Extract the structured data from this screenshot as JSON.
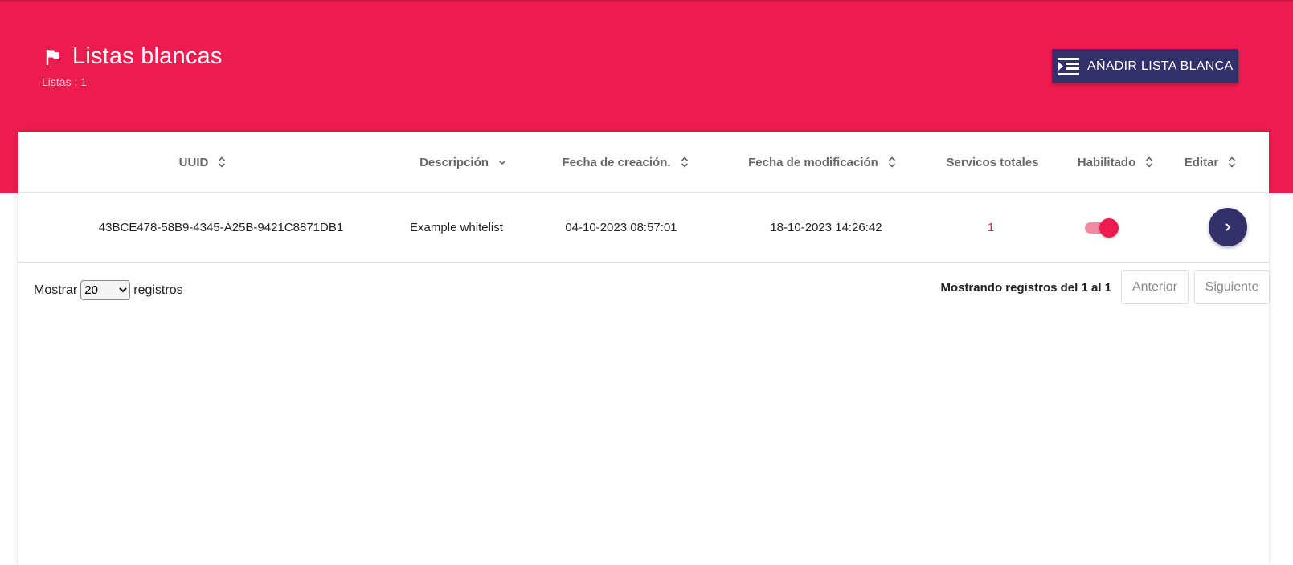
{
  "header": {
    "icon": "flag-icon",
    "title": "Listas blancas",
    "subtitle": "Listas : 1",
    "add_button_icon": "list-add-icon",
    "add_button_label": "AÑADIR LISTA BLANCA"
  },
  "colors": {
    "brand": "#ee1c4e",
    "accent": "#33306b"
  },
  "table": {
    "columns": [
      {
        "label": "UUID",
        "sortable": true
      },
      {
        "label": "Descripción",
        "sortable": true,
        "sort": "desc"
      },
      {
        "label": "Fecha de creación.",
        "sortable": true
      },
      {
        "label": "Fecha de modificación",
        "sortable": true
      },
      {
        "label": "Servicos totales",
        "sortable": false
      },
      {
        "label": "Habilitado",
        "sortable": true
      },
      {
        "label": "Editar",
        "sortable": true
      }
    ],
    "rows": [
      {
        "uuid": "43BCE478-58B9-4345-A25B-9421C8871DB1",
        "description": "Example whitelist",
        "created": "04-10-2023 08:57:01",
        "modified": "18-10-2023 14:26:42",
        "services": "1",
        "enabled": true,
        "edit_icon": "chevron-right-icon"
      }
    ]
  },
  "footer": {
    "show_label": "Mostrar",
    "page_size": "20",
    "records_label": "registros",
    "info": "Mostrando registros del 1 al 1",
    "prev_label": "Anterior",
    "next_label": "Siguiente"
  }
}
